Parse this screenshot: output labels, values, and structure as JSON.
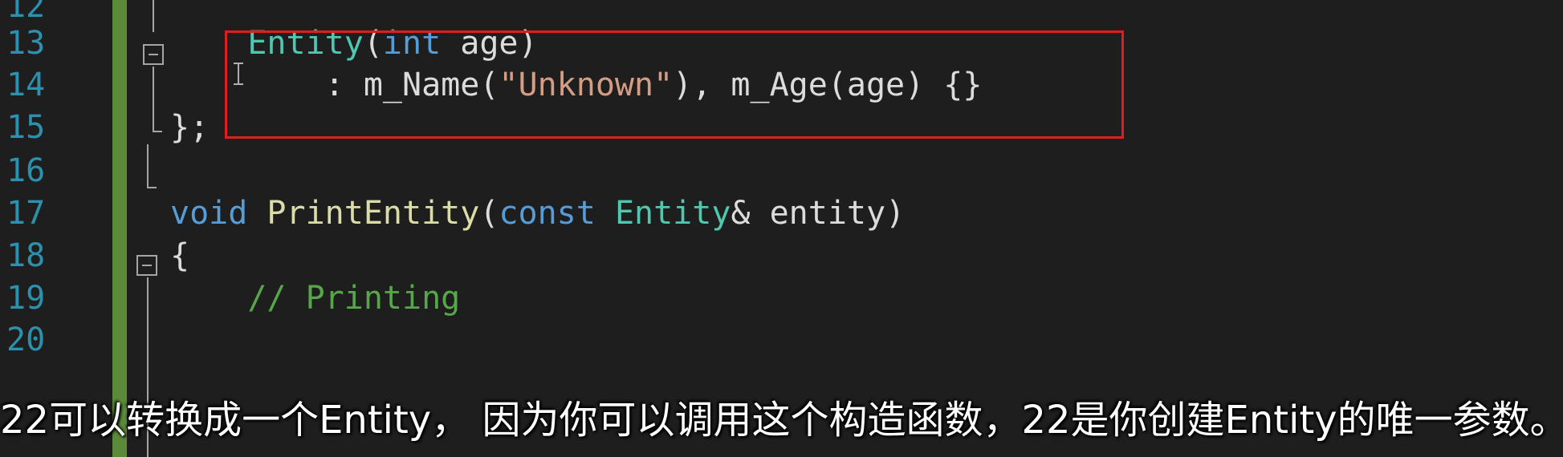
{
  "editor": {
    "lines": [
      {
        "number": "12",
        "segments": []
      },
      {
        "number": "13",
        "segments": [
          {
            "text": "    "
          },
          {
            "text": "Entity",
            "cls": "type"
          },
          {
            "text": "(",
            "cls": "plain"
          },
          {
            "text": "int",
            "cls": "kw"
          },
          {
            "text": " age)",
            "cls": "plain"
          }
        ]
      },
      {
        "number": "14",
        "segments": [
          {
            "text": "        : m_Name(",
            "cls": "plain"
          },
          {
            "text": "\"Unknown\"",
            "cls": "str"
          },
          {
            "text": "), m_Age(age) {}",
            "cls": "plain"
          }
        ]
      },
      {
        "number": "15",
        "segments": [
          {
            "text": "};",
            "cls": "plain"
          }
        ]
      },
      {
        "number": "16",
        "segments": []
      },
      {
        "number": "17",
        "segments": [
          {
            "text": "void",
            "cls": "kw"
          },
          {
            "text": " ",
            "cls": "plain"
          },
          {
            "text": "PrintEntity",
            "cls": "fn"
          },
          {
            "text": "(",
            "cls": "plain"
          },
          {
            "text": "const",
            "cls": "kw"
          },
          {
            "text": " ",
            "cls": "plain"
          },
          {
            "text": "Entity",
            "cls": "type"
          },
          {
            "text": "& entity)",
            "cls": "plain"
          }
        ]
      },
      {
        "number": "18",
        "segments": [
          {
            "text": "{",
            "cls": "plain"
          }
        ]
      },
      {
        "number": "19",
        "segments": [
          {
            "text": "    "
          },
          {
            "text": "// Printing",
            "cls": "cmt"
          }
        ]
      },
      {
        "number": "20",
        "segments": []
      }
    ]
  },
  "colors": {
    "background": "#1e1e1e",
    "line_number": "#2b91af",
    "change_bar": "#5b8a3a",
    "highlight_border": "#e01e1e"
  },
  "subtitle": {
    "text": "22可以转换成一个Entity， 因为你可以调用这个构造函数，22是你创建Entity的唯一参数。"
  }
}
